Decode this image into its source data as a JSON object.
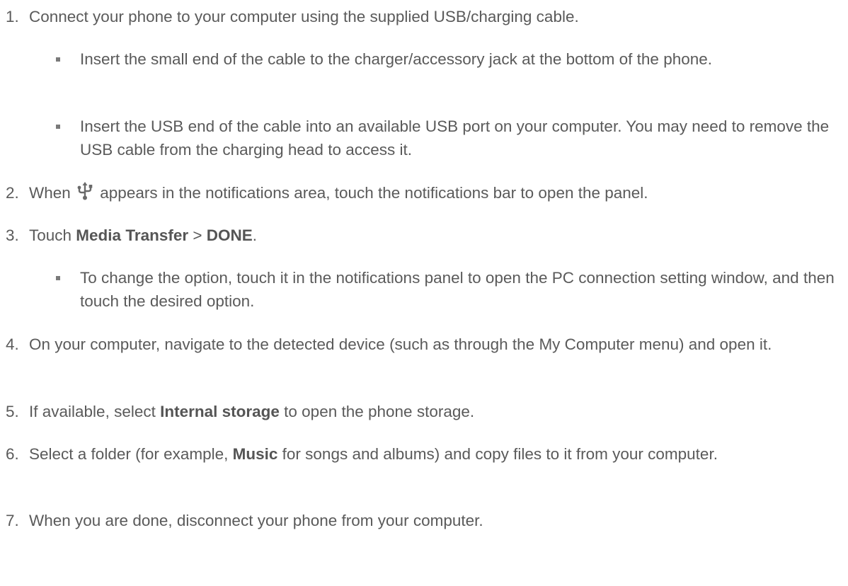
{
  "steps": [
    {
      "num": "1.",
      "text": "Connect your phone to your computer using the supplied USB/charging cable.",
      "sub": [
        "Insert the small end of the cable to the charger/accessory jack at the bottom of the phone.",
        "Insert the USB end of the cable into an available USB port on your computer. You may need to remove the USB cable from the charging head to access it."
      ]
    },
    {
      "num": "2.",
      "text_before_icon": "When",
      "icon": "usb-icon",
      "text_after_icon": "appears in the notifications area, touch the notifications bar to open the panel."
    },
    {
      "num": "3.",
      "text_a": "Touch ",
      "bold_a": "Media Transfer",
      "text_b": " > ",
      "bold_b": "DONE",
      "text_c": ".",
      "sub": [
        "To change the option, touch it in the notifications panel to open the PC connection setting window, and then touch the desired option."
      ]
    },
    {
      "num": "4.",
      "text": "On your computer, navigate to the detected device (such as through the My Computer menu) and open it."
    },
    {
      "num": "5.",
      "text_a": "If available, select ",
      "bold_a": "Internal storage",
      "text_b": " to open the phone storage."
    },
    {
      "num": "6.",
      "text_a": "Select a folder (for example, ",
      "bold_a": "Music",
      "text_b": " for songs and albums) and copy files to it from your computer."
    },
    {
      "num": "7.",
      "text": "When you are done, disconnect your phone from your computer."
    }
  ]
}
